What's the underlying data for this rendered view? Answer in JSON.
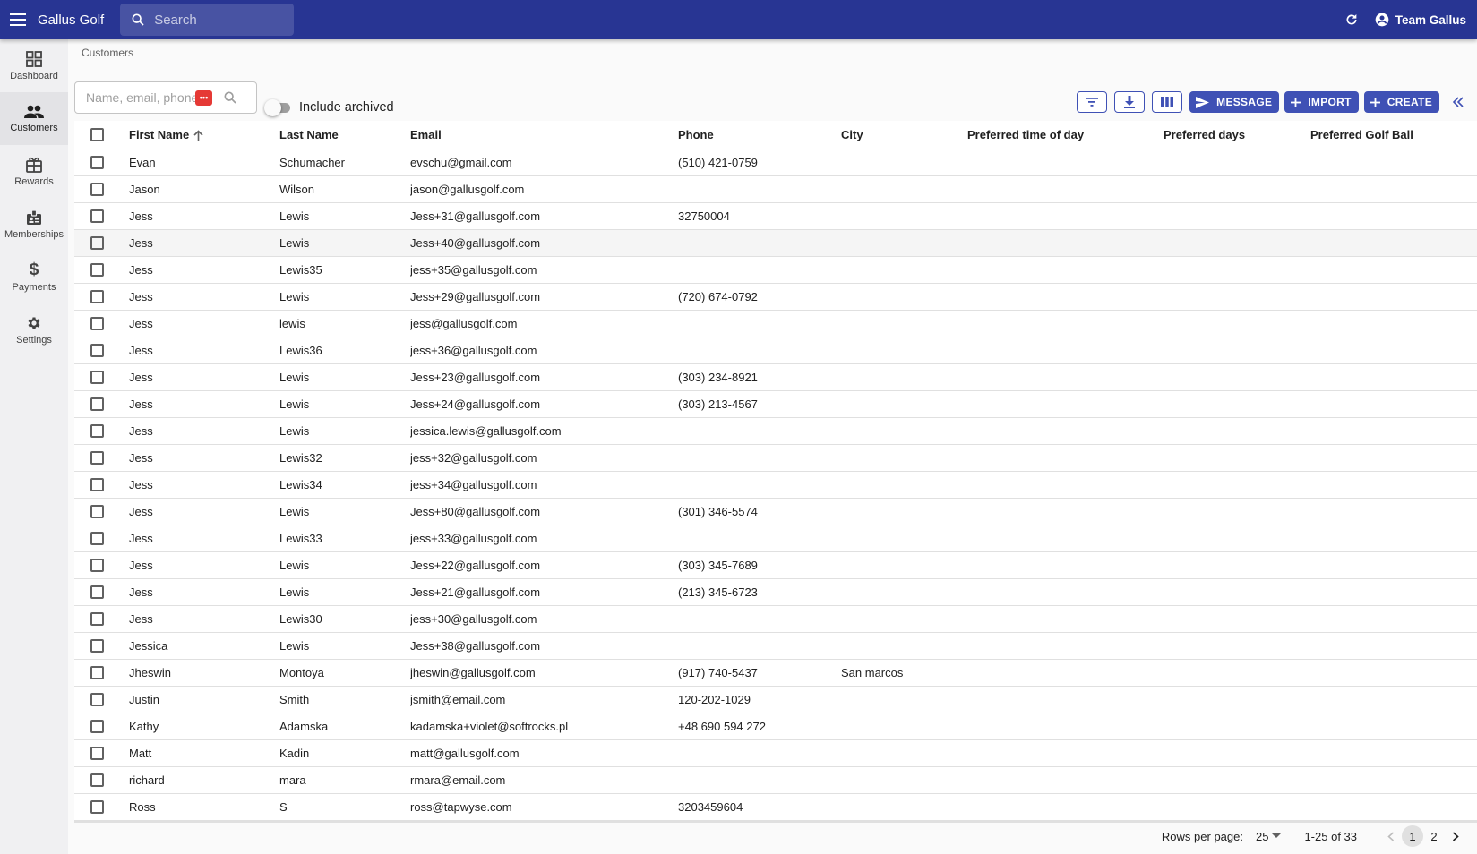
{
  "appbar": {
    "title": "Gallus Golf",
    "search_placeholder": "Search",
    "user_name": "Team Gallus"
  },
  "sidebar": {
    "items": [
      {
        "label": "Dashboard",
        "icon": "dashboard-icon"
      },
      {
        "label": "Customers",
        "icon": "people-icon",
        "active": true
      },
      {
        "label": "Rewards",
        "icon": "gift-icon"
      },
      {
        "label": "Memberships",
        "icon": "badge-icon"
      },
      {
        "label": "Payments",
        "icon": "dollar-icon"
      },
      {
        "label": "Settings",
        "icon": "gear-icon"
      }
    ]
  },
  "breadcrumb": "Customers",
  "filter": {
    "placeholder": "Name, email, phone",
    "badge": "•••",
    "include_archived_label": "Include archived"
  },
  "toolbar": {
    "message_label": "MESSAGE",
    "import_label": "IMPORT",
    "create_label": "CREATE"
  },
  "colors": {
    "appbar": "#283593",
    "primary": "#3f51b5",
    "badge": "#e53935"
  },
  "table": {
    "columns": [
      "First Name",
      "Last Name",
      "Email",
      "Phone",
      "City",
      "Preferred time of day",
      "Preferred days",
      "Preferred Golf Ball"
    ],
    "sort_column": "First Name",
    "sort_direction": "ascending",
    "rows": [
      [
        "Evan",
        "Schumacher",
        "evschu@gmail.com",
        "(510) 421-0759",
        "",
        "",
        "",
        ""
      ],
      [
        "Jason",
        "Wilson",
        "jason@gallusgolf.com",
        "",
        "",
        "",
        "",
        ""
      ],
      [
        "Jess",
        "Lewis",
        "Jess+31@gallusgolf.com",
        "32750004",
        "",
        "",
        "",
        ""
      ],
      [
        "Jess",
        "Lewis",
        "Jess+40@gallusgolf.com",
        "",
        "",
        "",
        "",
        ""
      ],
      [
        "Jess",
        "Lewis35",
        "jess+35@gallusgolf.com",
        "",
        "",
        "",
        "",
        ""
      ],
      [
        "Jess",
        "Lewis",
        "Jess+29@gallusgolf.com",
        "(720) 674-0792",
        "",
        "",
        "",
        ""
      ],
      [
        "Jess",
        "lewis",
        "jess@gallusgolf.com",
        "",
        "",
        "",
        "",
        ""
      ],
      [
        "Jess",
        "Lewis36",
        "jess+36@gallusgolf.com",
        "",
        "",
        "",
        "",
        ""
      ],
      [
        "Jess",
        "Lewis",
        "Jess+23@gallusgolf.com",
        "(303) 234-8921",
        "",
        "",
        "",
        ""
      ],
      [
        "Jess",
        "Lewis",
        "Jess+24@gallusgolf.com",
        "(303) 213-4567",
        "",
        "",
        "",
        ""
      ],
      [
        "Jess",
        "Lewis",
        "jessica.lewis@gallusgolf.com",
        "",
        "",
        "",
        "",
        ""
      ],
      [
        "Jess",
        "Lewis32",
        "jess+32@gallusgolf.com",
        "",
        "",
        "",
        "",
        ""
      ],
      [
        "Jess",
        "Lewis34",
        "jess+34@gallusgolf.com",
        "",
        "",
        "",
        "",
        ""
      ],
      [
        "Jess",
        "Lewis",
        "Jess+80@gallusgolf.com",
        "(301) 346-5574",
        "",
        "",
        "",
        ""
      ],
      [
        "Jess",
        "Lewis33",
        "jess+33@gallusgolf.com",
        "",
        "",
        "",
        "",
        ""
      ],
      [
        "Jess",
        "Lewis",
        "Jess+22@gallusgolf.com",
        "(303) 345-7689",
        "",
        "",
        "",
        ""
      ],
      [
        "Jess",
        "Lewis",
        "Jess+21@gallusgolf.com",
        "(213) 345-6723",
        "",
        "",
        "",
        ""
      ],
      [
        "Jess",
        "Lewis30",
        "jess+30@gallusgolf.com",
        "",
        "",
        "",
        "",
        ""
      ],
      [
        "Jessica",
        "Lewis",
        "Jess+38@gallusgolf.com",
        "",
        "",
        "",
        "",
        ""
      ],
      [
        "Jheswin",
        "Montoya",
        "jheswin@gallusgolf.com",
        "(917) 740-5437",
        "San marcos",
        "",
        "",
        ""
      ],
      [
        "Justin",
        "Smith",
        "jsmith@email.com",
        "120-202-1029",
        "",
        "",
        "",
        ""
      ],
      [
        "Kathy",
        "Adamska",
        "kadamska+violet@softrocks.pl",
        "+48 690 594 272",
        "",
        "",
        "",
        ""
      ],
      [
        "Matt",
        "Kadin",
        "matt@gallusgolf.com",
        "",
        "",
        "",
        "",
        ""
      ],
      [
        "richard",
        "mara",
        "rmara@email.com",
        "",
        "",
        "",
        "",
        ""
      ],
      [
        "Ross",
        "S",
        "ross@tapwyse.com",
        "3203459604",
        "",
        "",
        "",
        ""
      ]
    ]
  },
  "pagination": {
    "rows_per_page_label": "Rows per page:",
    "rows_per_page": "25",
    "range": "1-25 of 33",
    "pages": [
      "1",
      "2"
    ],
    "current_page": "1"
  }
}
